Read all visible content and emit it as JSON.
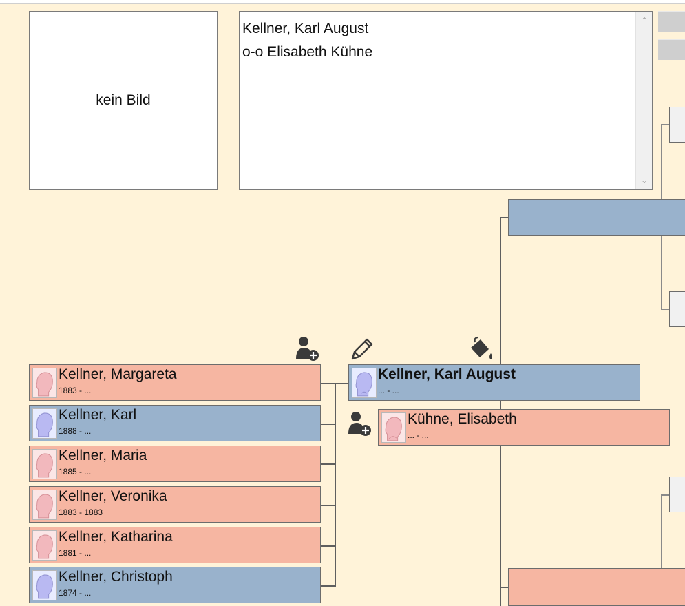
{
  "photo": {
    "placeholder": "kein Bild"
  },
  "notes": {
    "lines": [
      "Kellner, Karl August",
      "o-o Elisabeth Kühne"
    ]
  },
  "children": [
    {
      "name": "Kellner, Margareta",
      "dates": "1883 - ...",
      "sex": "female"
    },
    {
      "name": "Kellner, Karl",
      "dates": "1888 - ...",
      "sex": "male"
    },
    {
      "name": "Kellner, Maria",
      "dates": "1885 - ...",
      "sex": "female"
    },
    {
      "name": "Kellner, Veronika",
      "dates": "1883 - 1883",
      "sex": "female"
    },
    {
      "name": "Kellner, Katharina",
      "dates": "1881 - ...",
      "sex": "female"
    },
    {
      "name": "Kellner, Christoph",
      "dates": "1874 - ...",
      "sex": "male"
    }
  ],
  "focus": {
    "name": "Kellner, Karl August",
    "dates": "... - ...",
    "sex": "male"
  },
  "spouse": {
    "name": "Kühne, Elisabeth",
    "dates": "... - ...",
    "sex": "female"
  },
  "icons": {
    "add_child": "add-person-icon",
    "edit": "pencil-icon",
    "color": "paint-bucket-icon",
    "add_spouse": "add-person-icon"
  },
  "colors": {
    "male": "#99b2cc",
    "female": "#f6b6a2",
    "background": "#fff3d9"
  }
}
